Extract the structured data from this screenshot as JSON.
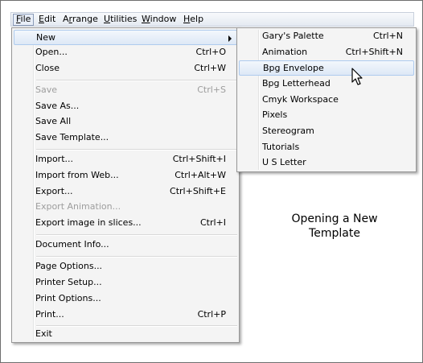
{
  "menubar": {
    "items": [
      {
        "label": "File",
        "accel": "F",
        "rest": "ile"
      },
      {
        "label": "Edit",
        "accel": "E",
        "rest": "dit"
      },
      {
        "label": "Arrange",
        "pre": "A",
        "accel": "r",
        "rest": "range"
      },
      {
        "label": "Utilities",
        "accel": "U",
        "rest": "tilities"
      },
      {
        "label": "Window",
        "accel": "W",
        "rest": "indow"
      },
      {
        "label": "Help",
        "accel": "H",
        "rest": "elp"
      }
    ]
  },
  "file_menu": {
    "items": [
      {
        "label": "New",
        "shortcut": "",
        "submenu": true
      },
      {
        "label": "Open...",
        "shortcut": "Ctrl+O"
      },
      {
        "label": "Close",
        "shortcut": "Ctrl+W"
      },
      {
        "label": "Save",
        "shortcut": "Ctrl+S",
        "disabled": true
      },
      {
        "label": "Save As...",
        "shortcut": ""
      },
      {
        "label": "Save All",
        "shortcut": ""
      },
      {
        "label": "Save Template...",
        "shortcut": ""
      },
      {
        "label": "Import...",
        "shortcut": "Ctrl+Shift+I"
      },
      {
        "label": "Import from Web...",
        "shortcut": "Ctrl+Alt+W"
      },
      {
        "label": "Export...",
        "shortcut": "Ctrl+Shift+E"
      },
      {
        "label": "Export Animation...",
        "shortcut": "",
        "disabled": true
      },
      {
        "label": "Export image in slices...",
        "shortcut": "Ctrl+I"
      },
      {
        "label": "Document Info...",
        "shortcut": ""
      },
      {
        "label": "Page Options...",
        "shortcut": ""
      },
      {
        "label": "Printer Setup...",
        "shortcut": ""
      },
      {
        "label": "Print Options...",
        "shortcut": ""
      },
      {
        "label": "Print...",
        "shortcut": "Ctrl+P"
      },
      {
        "label": "Exit",
        "shortcut": ""
      }
    ]
  },
  "new_submenu": {
    "items": [
      {
        "label": "Gary's Palette",
        "shortcut": "Ctrl+N"
      },
      {
        "label": "Animation",
        "shortcut": "Ctrl+Shift+N"
      },
      {
        "label": "Bpg Envelope",
        "shortcut": "",
        "highlighted": true
      },
      {
        "label": "Bpg Letterhead",
        "shortcut": ""
      },
      {
        "label": "Cmyk Workspace",
        "shortcut": ""
      },
      {
        "label": "Pixels",
        "shortcut": ""
      },
      {
        "label": "Stereogram",
        "shortcut": ""
      },
      {
        "label": "Tutorials",
        "shortcut": ""
      },
      {
        "label": "U S Letter",
        "shortcut": ""
      }
    ]
  },
  "caption": {
    "line1": "Opening a New",
    "line2": "Template"
  },
  "colors": {
    "highlight_border": "#aecbee",
    "disabled_text": "#9d9d9d",
    "menu_bg": "#f4f4f4"
  }
}
